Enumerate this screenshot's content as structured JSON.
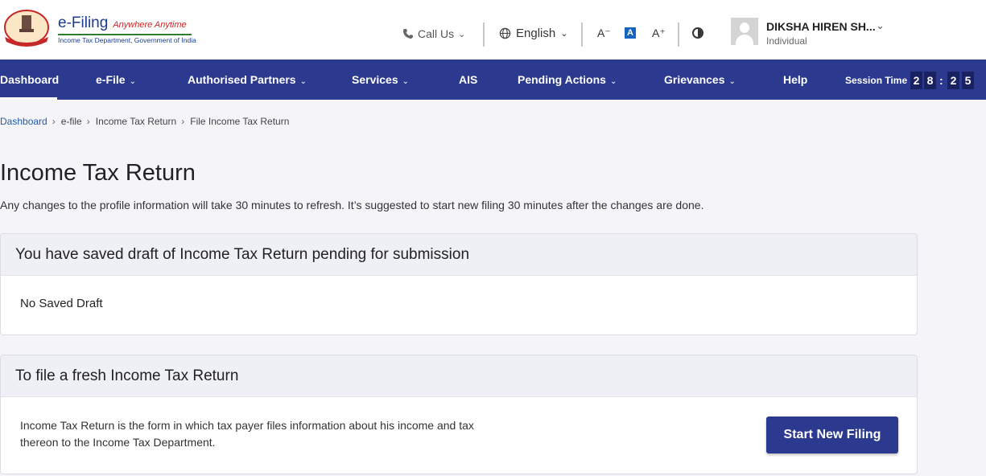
{
  "header": {
    "brand_main": "e-Filing",
    "brand_tagline": "Anywhere Anytime",
    "brand_sub": "Income Tax Department, Government of India",
    "call_us": "Call Us",
    "language": "English",
    "font_decrease": "A⁻",
    "font_default": "A",
    "font_increase": "A⁺",
    "user_name": "DIKSHA HIREN SH...",
    "user_role": "Individual",
    "icons": [
      "phone-icon",
      "globe-icon",
      "contrast-icon",
      "chevron-down-icon",
      "avatar"
    ]
  },
  "nav": {
    "items": [
      {
        "label": "Dashboard",
        "dropdown": false,
        "active": true
      },
      {
        "label": "e-File",
        "dropdown": true
      },
      {
        "label": "Authorised Partners",
        "dropdown": true
      },
      {
        "label": "Services",
        "dropdown": true
      },
      {
        "label": "AIS",
        "dropdown": false
      },
      {
        "label": "Pending Actions",
        "dropdown": true
      },
      {
        "label": "Grievances",
        "dropdown": true
      },
      {
        "label": "Help",
        "dropdown": false
      }
    ],
    "session_label": "Session Time",
    "session_digits": [
      "2",
      "8",
      "2",
      "5"
    ]
  },
  "breadcrumb": [
    "Dashboard",
    "e-file",
    "Income Tax Return",
    "File Income Tax Return"
  ],
  "page": {
    "title": "Income Tax Return",
    "note": "Any changes to the profile information will take 30 minutes to refresh. It’s suggested to start new filing 30 minutes after the changes are done."
  },
  "draft_card": {
    "title": "You have saved draft of Income Tax Return pending for submission",
    "body": "No Saved Draft"
  },
  "fresh_card": {
    "title": "To file a fresh Income Tax Return",
    "desc_line1": "Income Tax Return is the form in which tax payer files information about his income and tax",
    "desc_line2": "thereon to the Income Tax Department.",
    "button": "Start New Filing"
  },
  "colors": {
    "nav_bg": "#2b3a8e",
    "page_bg": "#f5f5f9",
    "card_head_bg": "#eef0f6",
    "link": "#2359a8"
  }
}
